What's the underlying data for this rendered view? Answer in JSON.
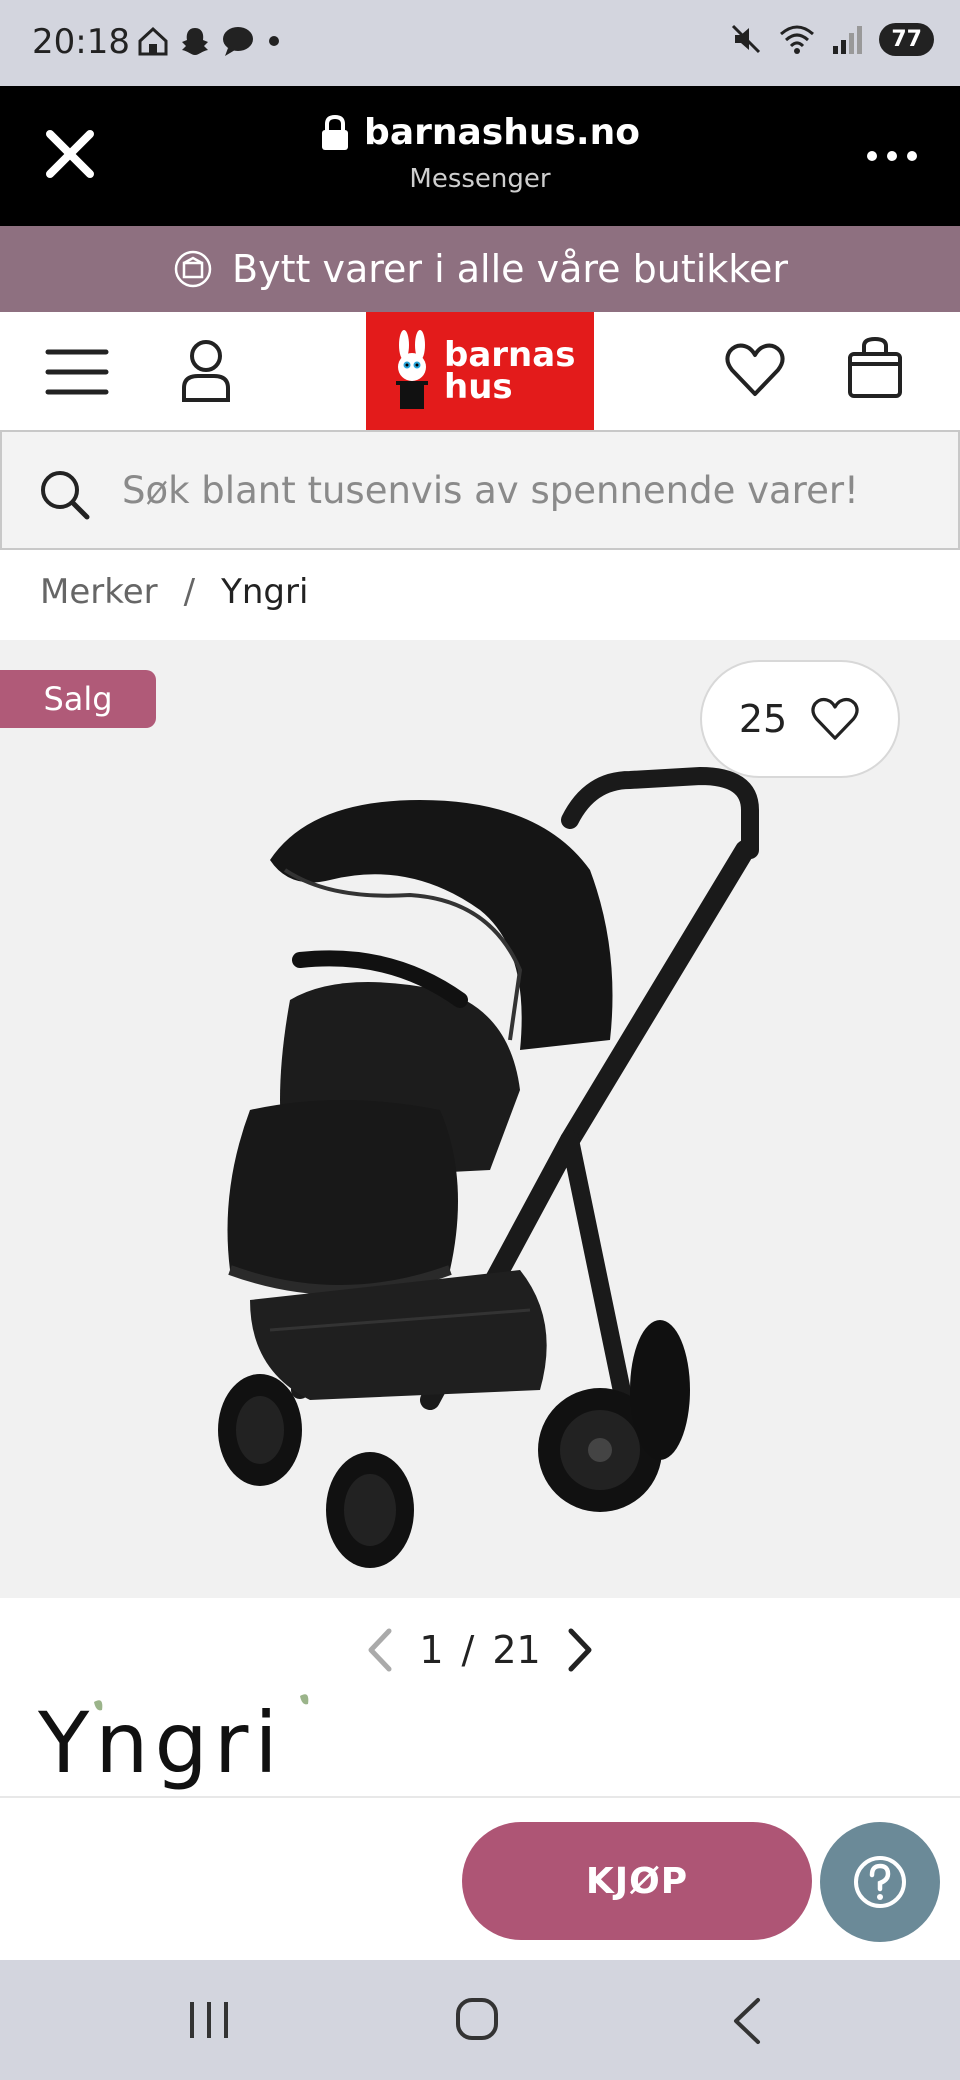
{
  "status_bar": {
    "time": "20:18",
    "battery": "77",
    "left_icons": [
      "home-icon",
      "snapchat-icon",
      "chat-bubble-icon",
      "dot-icon"
    ],
    "right_icons": [
      "mute-icon",
      "wifi-icon",
      "signal-icon"
    ]
  },
  "browser": {
    "domain": "barnashus.no",
    "subtitle": "Messenger"
  },
  "promo": {
    "text": "Bytt varer i alle våre butikker"
  },
  "header": {
    "logo_line1": "barnas",
    "logo_line2": "hus",
    "logo_color": "#e31b1b"
  },
  "search": {
    "placeholder": "Søk blant tusenvis av spennende varer!"
  },
  "breadcrumb": {
    "items": [
      "Merker",
      "Yngri"
    ],
    "separator": "/"
  },
  "product": {
    "sale_badge": "Salg",
    "favorites_count": "25",
    "accent_color": "#ae5575"
  },
  "pager": {
    "current": "1",
    "separator": "/",
    "total": "21"
  },
  "brand": {
    "name": "Yngri"
  },
  "actions": {
    "buy_label": "KJØP"
  }
}
